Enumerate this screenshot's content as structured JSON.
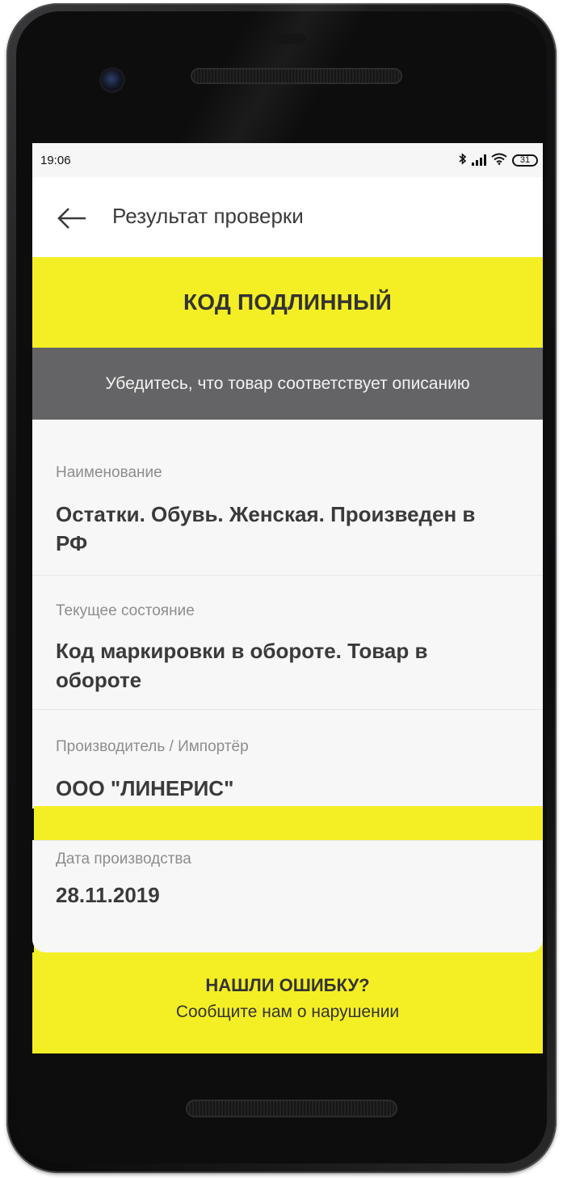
{
  "status_bar": {
    "time": "19:06",
    "icons": [
      "bluetooth-icon",
      "signal-icon",
      "wifi-icon",
      "battery-icon"
    ],
    "battery": "31"
  },
  "app_bar": {
    "back_icon": "arrow-left-icon",
    "title": "Результат проверки"
  },
  "result": {
    "status": "КОД ПОДЛИННЫЙ",
    "hint": "Убедитесь, что товар соответствует описанию"
  },
  "details": [
    {
      "label": "Наименование",
      "value": "Остатки. Обувь. Женская. Произведен в РФ"
    },
    {
      "label": "Текущее состояние",
      "value": "Код маркировки в обороте. Товар в обороте"
    },
    {
      "label": "Производитель / Импортёр",
      "value": "ООО \"ЛИНЕРИС\""
    },
    {
      "label": "Дата производства",
      "value": "28.11.2019"
    }
  ],
  "report": {
    "title": "НАШЛИ ОШИБКУ?",
    "subtitle": "Сообщите нам о нарушении"
  },
  "colors": {
    "accent_yellow": "#f4ef24",
    "hint_gray": "#646466",
    "background": "#f7f7f7"
  }
}
